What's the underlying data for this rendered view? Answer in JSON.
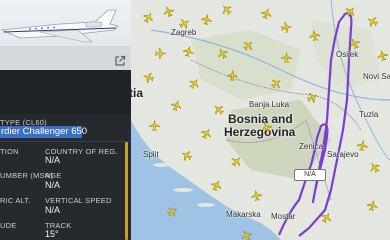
{
  "panel": {
    "aircraft_type_label": "TYPE (CL60)",
    "aircraft_type_value": "rdier Challenger 650",
    "fields": [
      {
        "label": "TION",
        "value": ""
      },
      {
        "label": "COUNTRY OF REG.",
        "value": "N/A"
      },
      {
        "label": "UMBER (MSN)",
        "value": ""
      },
      {
        "label": "AGE",
        "value": "N/A"
      },
      {
        "label": "RIC ALT.",
        "value": ""
      },
      {
        "label": "VERTICAL SPEED",
        "value": "N/A"
      },
      {
        "label": "UDE",
        "value": ""
      },
      {
        "label": "TRACK",
        "value": "15°"
      }
    ],
    "accent_color": "#c9a227",
    "highlight_color": "#3b6fc4"
  },
  "map": {
    "country_label_1": "Bosnia and",
    "country_label_2": "Herzegovina",
    "country_label_3": "tia",
    "cities": [
      "Zagreb",
      "Banja Luka",
      "Osijek",
      "Novi Sad",
      "Split",
      "Makarska",
      "Mostar",
      "Sarajevo",
      "Zenica",
      "Tuzla"
    ],
    "marker_label": "N/A",
    "track_color": "#7a3fd1",
    "plane_color": "#f2d20a",
    "icon": "external-link-icon"
  }
}
